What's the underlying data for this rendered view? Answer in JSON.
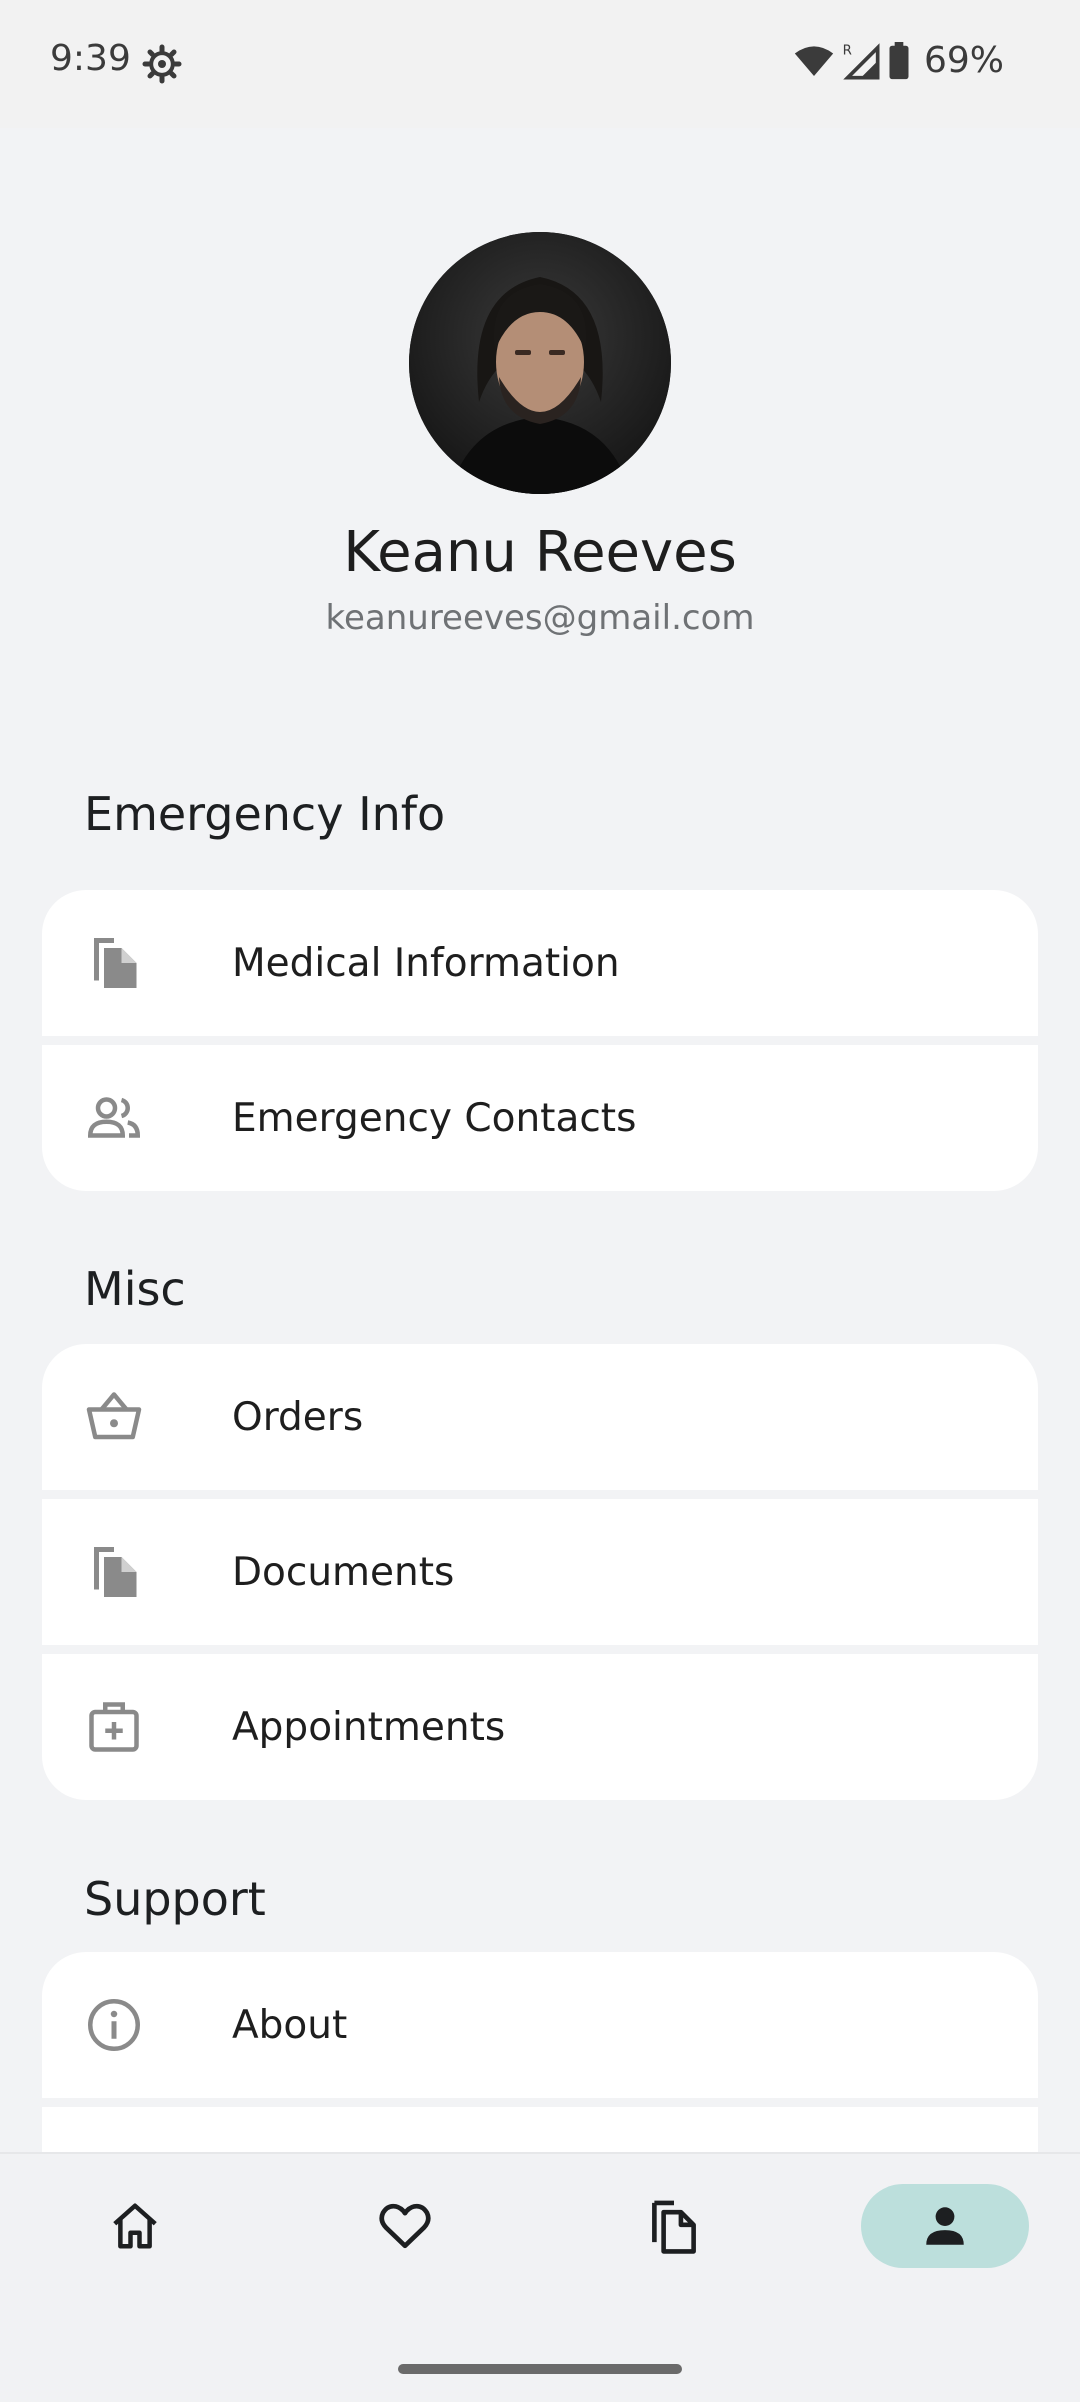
{
  "status_bar": {
    "time": "9:39",
    "battery": "69%",
    "icons": [
      "settings-gear-icon",
      "wifi-icon",
      "signal-roaming-icon",
      "battery-icon"
    ]
  },
  "profile": {
    "name": "Keanu Reeves",
    "email": "keanureeves@gmail.com"
  },
  "sections": {
    "emergency": {
      "title": "Emergency Info",
      "items": [
        {
          "label": "Medical Information",
          "icon": "file-copy-icon"
        },
        {
          "label": "Emergency Contacts",
          "icon": "people-icon"
        }
      ]
    },
    "misc": {
      "title": "Misc",
      "items": [
        {
          "label": "Orders",
          "icon": "basket-icon"
        },
        {
          "label": "Documents",
          "icon": "file-copy-icon"
        },
        {
          "label": "Appointments",
          "icon": "medical-bag-icon"
        }
      ]
    },
    "support": {
      "title": "Support",
      "items": [
        {
          "label": "About",
          "icon": "info-icon"
        }
      ]
    }
  },
  "bottom_nav": {
    "items": [
      "home-icon",
      "heart-icon",
      "documents-icon",
      "person-icon"
    ],
    "active": "person-icon"
  },
  "colors": {
    "background": "#f2f3f5",
    "card": "#ffffff",
    "active_nav": "#bcdfdc",
    "icon_gray": "#8a8a8a"
  }
}
